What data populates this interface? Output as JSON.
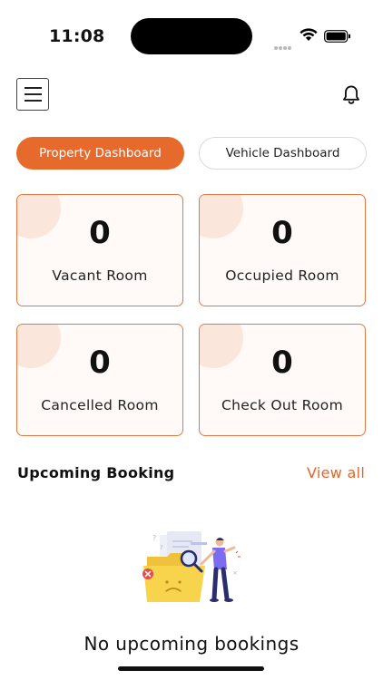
{
  "status_bar": {
    "time": "11:08"
  },
  "header": {
    "menu_icon": "hamburger-menu-icon",
    "bell_icon": "bell-icon"
  },
  "tabs": [
    {
      "label": "Property Dashboard",
      "active": true
    },
    {
      "label": "Vehicle Dashboard",
      "active": false
    }
  ],
  "stats": [
    {
      "value": "0",
      "label": "Vacant Room"
    },
    {
      "value": "0",
      "label": "Occupied Room"
    },
    {
      "value": "0",
      "label": "Cancelled Room"
    },
    {
      "value": "0",
      "label": "Check Out Room"
    }
  ],
  "upcoming": {
    "title": "Upcoming Booking",
    "view_all": "View all",
    "empty_message": "No upcoming bookings"
  },
  "colors": {
    "accent": "#e66a2c",
    "card_border": "#e07a44",
    "card_bg": "#fffaf7"
  }
}
